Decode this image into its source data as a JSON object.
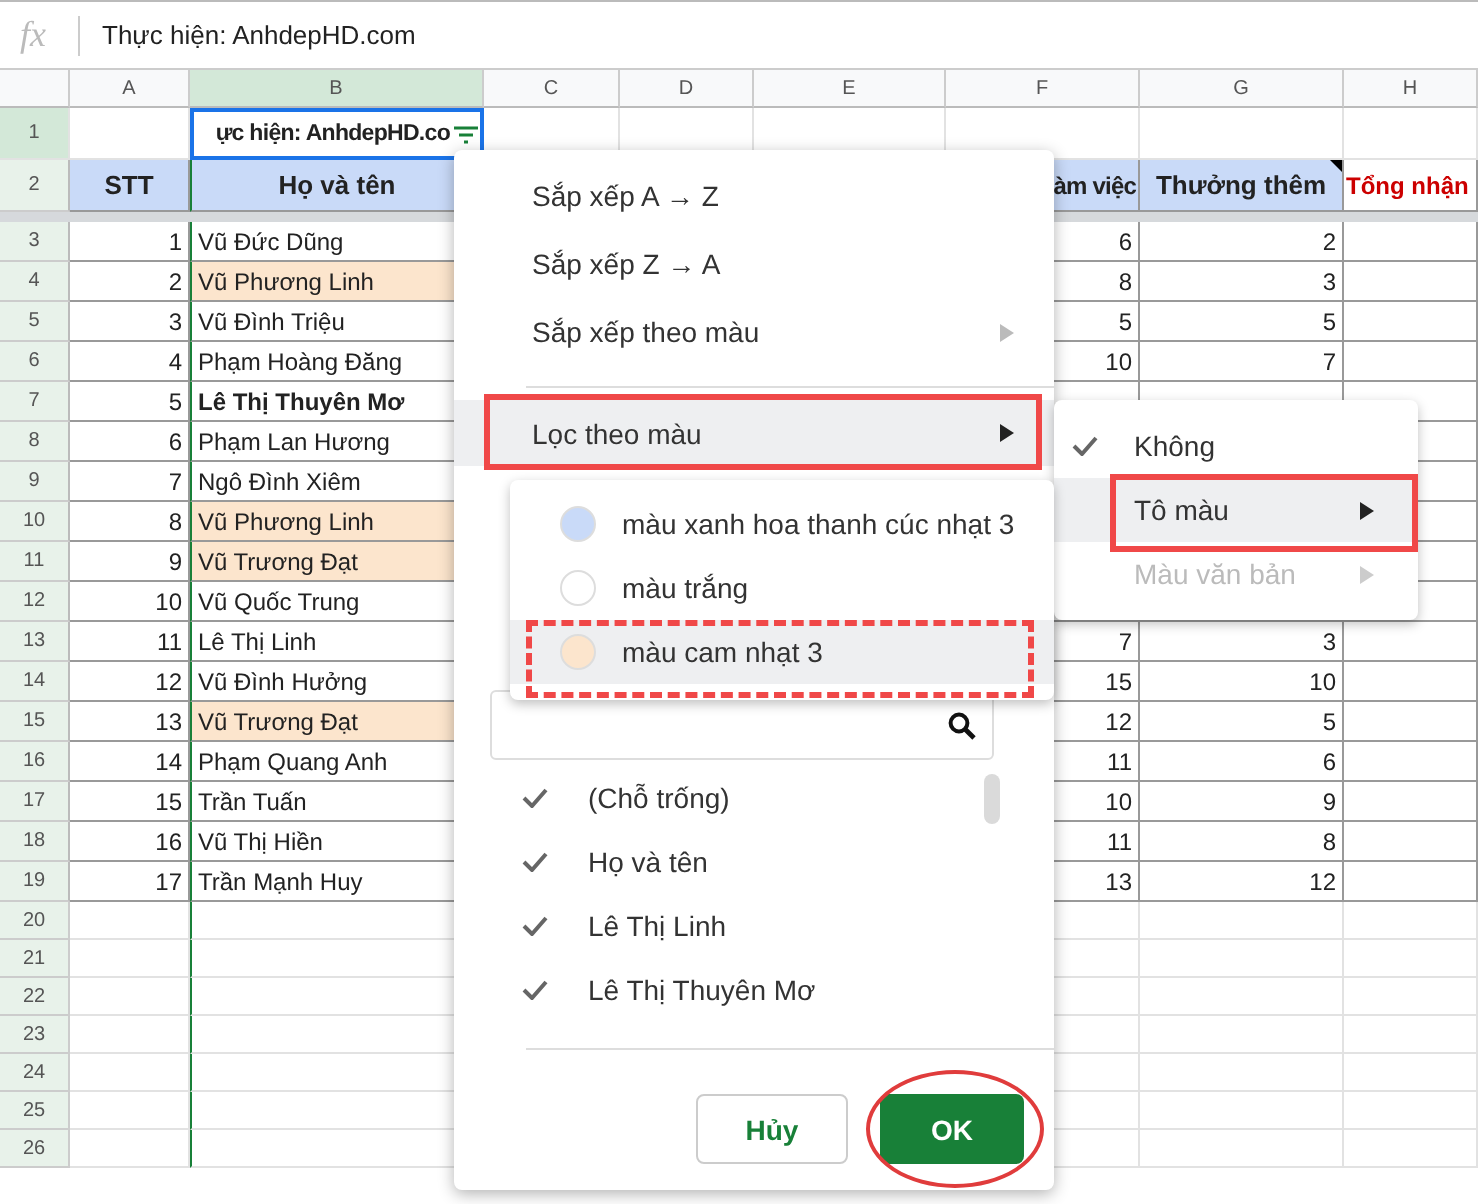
{
  "formula_bar": {
    "fx": "fx",
    "value": "Thực hiện: AnhdepHD.com"
  },
  "columns": [
    "A",
    "B",
    "C",
    "D",
    "E",
    "F",
    "G",
    "H"
  ],
  "title_row": {
    "number": "1",
    "text": "ực hiện: AnhdepHD.co",
    "filter": true
  },
  "header_row": {
    "number": "2",
    "stt": "STT",
    "name": "Họ và tên",
    "column_f": "àm việc",
    "column_g": "Thưởng thêm",
    "column_g_note": true,
    "column_h": "Tổng nhận"
  },
  "rows": [
    {
      "number": "3",
      "stt": "1",
      "name": "Vũ Đức Dũng",
      "bold": false,
      "color": "#ffffff",
      "column_f": "6",
      "column_g": "2"
    },
    {
      "number": "4",
      "stt": "2",
      "name": "Vũ Phương Linh",
      "bold": false,
      "color": "#fce5cd",
      "column_f": "8",
      "column_g": "3"
    },
    {
      "number": "5",
      "stt": "3",
      "name": "Vũ Đình Triệu",
      "bold": false,
      "color": "#ffffff",
      "column_f": "5",
      "column_g": "5"
    },
    {
      "number": "6",
      "stt": "4",
      "name": "Phạm Hoàng Đăng",
      "bold": false,
      "color": "#ffffff",
      "column_f": "10",
      "column_g": "7"
    },
    {
      "number": "7",
      "stt": "5",
      "name": "Lê Thị Thuyên Mơ",
      "bold": true,
      "color": "#ffffff"
    },
    {
      "number": "8",
      "stt": "6",
      "name": "Phạm Lan Hương",
      "bold": false,
      "color": "#ffffff"
    },
    {
      "number": "9",
      "stt": "7",
      "name": "Ngô Đình Xiêm",
      "bold": false,
      "color": "#ffffff"
    },
    {
      "number": "10",
      "stt": "8",
      "name": "Vũ Phương Linh",
      "bold": false,
      "color": "#fce5cd"
    },
    {
      "number": "11",
      "stt": "9",
      "name": "Vũ Trương Đạt",
      "bold": false,
      "color": "#fce5cd"
    },
    {
      "number": "12",
      "stt": "10",
      "name": "Vũ Quốc Trung",
      "bold": false,
      "color": "#ffffff"
    },
    {
      "number": "13",
      "stt": "11",
      "name": "Lê Thị Linh",
      "bold": false,
      "color": "#ffffff",
      "column_f": "7",
      "column_g": "3"
    },
    {
      "number": "14",
      "stt": "12",
      "name": "Vũ Đình Hưởng",
      "bold": false,
      "color": "#ffffff",
      "column_f": "15",
      "column_g": "10"
    },
    {
      "number": "15",
      "stt": "13",
      "name": "Vũ Trương Đạt",
      "bold": false,
      "color": "#fce5cd",
      "column_f": "12",
      "column_g": "5"
    },
    {
      "number": "16",
      "stt": "14",
      "name": "Phạm Quang Anh",
      "bold": false,
      "color": "#ffffff",
      "column_f": "11",
      "column_g": "6"
    },
    {
      "number": "17",
      "stt": "15",
      "name": "Trần Tuấn",
      "bold": false,
      "color": "#ffffff",
      "column_f": "10",
      "column_g": "9"
    },
    {
      "number": "18",
      "stt": "16",
      "name": "Vũ Thị Hiền",
      "bold": false,
      "color": "#ffffff",
      "column_f": "11",
      "column_g": "8"
    },
    {
      "number": "19",
      "stt": "17",
      "name": "Trần Mạnh Huy",
      "bold": false,
      "color": "#ffffff",
      "column_f": "13",
      "column_g": "12"
    }
  ],
  "empty_rows": [
    "20",
    "21",
    "22",
    "23",
    "24",
    "25",
    "26"
  ],
  "filter_menu": {
    "sort_items": [
      {
        "label": "Sắp xếp A → Z",
        "submenu": false
      },
      {
        "label": "Sắp xếp Z → A",
        "submenu": false
      },
      {
        "label": "Sắp xếp theo màu",
        "submenu": true
      }
    ],
    "filter_item": {
      "label": "Lọc theo màu",
      "submenu": true,
      "selected": true,
      "outlined": true
    },
    "values": [
      {
        "label": "(Chỗ trống)",
        "checked": true
      },
      {
        "label": "Họ và tên",
        "checked": true
      },
      {
        "label": "Lê Thị Linh",
        "checked": true
      },
      {
        "label": "Lê Thị Thuyên Mơ",
        "checked": true
      }
    ],
    "buttons": [
      {
        "label": "Hủy",
        "kind": "secondary",
        "circled": false
      },
      {
        "label": "OK",
        "kind": "primary",
        "circled": true
      }
    ]
  },
  "color_filter_submenu": {
    "items": [
      {
        "label": "Không",
        "checked": true,
        "submenu": false,
        "disabled": false,
        "selected": false,
        "outlined": false
      },
      {
        "label": "Tô màu",
        "checked": false,
        "submenu": true,
        "disabled": false,
        "selected": true,
        "outlined": true
      },
      {
        "label": "Màu văn bản",
        "checked": false,
        "submenu": true,
        "disabled": true,
        "selected": false,
        "outlined": false
      }
    ]
  },
  "fill_color_submenu": {
    "items": [
      {
        "label": "màu xanh hoa thanh cúc nhạt 3",
        "color": "#c9daf8",
        "selected": false,
        "dashed_outline": false
      },
      {
        "label": "màu trắng",
        "color": "#ffffff",
        "selected": false,
        "dashed_outline": false
      },
      {
        "label": "màu cam nhạt 3",
        "color": "#fce5cd",
        "selected": true,
        "dashed_outline": true
      }
    ]
  }
}
